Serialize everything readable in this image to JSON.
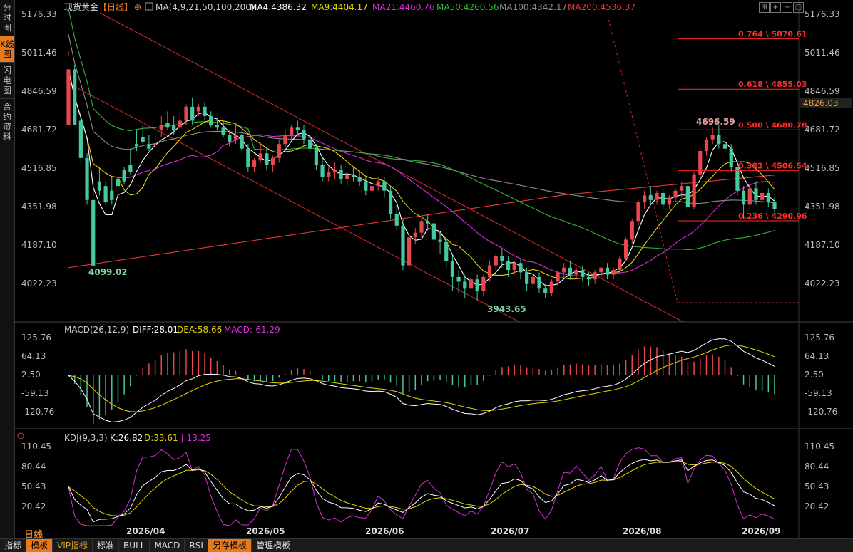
{
  "sidebar": {
    "tabs": [
      "分时图",
      "K线图",
      "闪电图",
      "合约资料"
    ],
    "active": 1
  },
  "header": {
    "name": "现货黄金",
    "period": "【日线】",
    "ma_params": "MA(4,9,21,50,100,200)",
    "ma4": "MA4:4386.32",
    "ma9": "MA9:4404.17",
    "ma21": "MA21:4460.76",
    "ma50": "MA50:4260.56",
    "ma100": "MA100:4342.17",
    "ma200": "MA200:4536.37"
  },
  "colors": {
    "up": "#e8474e",
    "down": "#46c8a0",
    "ma4": "#ffffff",
    "ma9": "#e6d400",
    "ma21": "#d431d4",
    "ma50": "#35b535",
    "ma100": "#8c8c8c",
    "ma200": "#e23a3a",
    "accent": "#e87a1e",
    "fib": "#ff2a2a"
  },
  "price_axis": [
    "5176.33",
    "5011.46",
    "4846.59",
    "4681.72",
    "4516.85",
    "4351.98",
    "4187.10",
    "4022.23"
  ],
  "current_price": "4826.03",
  "annotations": {
    "low1": "4099.02",
    "low2": "3943.65",
    "high1": "4696.59"
  },
  "fib_levels": [
    "0.764 \\ 5070.61",
    "0.618 \\ 4855.03",
    "0.500 \\ 4680.78",
    "0.382 \\ 4506.54",
    "0.236 \\ 4290.96"
  ],
  "macd": {
    "title": "MACD(26,12,9)",
    "diff": "DIFF:28.01",
    "dea": "DEA:58.66",
    "macd": "MACD:-61.29",
    "axis": [
      "125.76",
      "64.13",
      "2.50",
      "-59.13",
      "-120.76"
    ]
  },
  "kdj": {
    "title": "KDJ(9,3,3)",
    "k": "K:26.82",
    "d": "D:33.61",
    "j": "J:13.25",
    "axis": [
      "110.45",
      "80.44",
      "50.43",
      "20.42"
    ]
  },
  "x_axis": [
    "2026/04",
    "2026/05",
    "2026/06",
    "2026/07",
    "2026/08",
    "2026/09"
  ],
  "period_label": "日线",
  "bottom_buttons": [
    "指标",
    "模板",
    "VIP指标",
    "标准",
    "BULL",
    "MACD",
    "RSI",
    "另存模板",
    "管理模板"
  ],
  "chart_data": [
    {
      "type": "candlestick",
      "title": "现货黄金 日线",
      "ylim": [
        3940,
        5176.33
      ],
      "y_ticks": [
        5176.33,
        5011.46,
        4846.59,
        4681.72,
        4516.85,
        4351.98,
        4187.1,
        4022.23
      ],
      "x_ticks": [
        "2026/04",
        "2026/05",
        "2026/06",
        "2026/07",
        "2026/08",
        "2026/09"
      ],
      "candles": [
        [
          4700,
          5000,
          4940,
          5020
        ],
        [
          4940,
          4960,
          4700,
          4720
        ],
        [
          4720,
          4760,
          4560,
          4540
        ],
        [
          4560,
          4580,
          4380,
          4360
        ],
        [
          4380,
          4400,
          4099,
          4460
        ],
        [
          4460,
          4520,
          4420,
          4400
        ],
        [
          4440,
          4460,
          4370,
          4360
        ],
        [
          4420,
          4480,
          4380,
          4360
        ],
        [
          4470,
          4510,
          4440,
          4430
        ],
        [
          4510,
          4520,
          4460,
          4450
        ],
        [
          4530,
          4600,
          4500,
          4490
        ],
        [
          4620,
          4680,
          4610,
          4590
        ],
        [
          4650,
          4700,
          4630,
          4620
        ],
        [
          4620,
          4660,
          4600,
          4590
        ],
        [
          4620,
          4680,
          4620,
          4610
        ],
        [
          4680,
          4740,
          4700,
          4650
        ],
        [
          4710,
          4760,
          4690,
          4680
        ],
        [
          4700,
          4740,
          4680,
          4660
        ],
        [
          4690,
          4760,
          4720,
          4670
        ],
        [
          4720,
          4790,
          4780,
          4700
        ],
        [
          4780,
          4820,
          4720,
          4700
        ],
        [
          4760,
          4790,
          4780,
          4740
        ],
        [
          4780,
          4800,
          4740,
          4720
        ],
        [
          4740,
          4760,
          4700,
          4690
        ],
        [
          4700,
          4730,
          4690,
          4680
        ],
        [
          4690,
          4720,
          4660,
          4650
        ],
        [
          4660,
          4680,
          4630,
          4610
        ],
        [
          4640,
          4700,
          4660,
          4620
        ],
        [
          4660,
          4680,
          4600,
          4590
        ],
        [
          4600,
          4620,
          4520,
          4500
        ],
        [
          4520,
          4560,
          4550,
          4500
        ],
        [
          4550,
          4620,
          4580,
          4540
        ],
        [
          4580,
          4600,
          4530,
          4510
        ],
        [
          4530,
          4570,
          4560,
          4500
        ],
        [
          4560,
          4640,
          4620,
          4540
        ],
        [
          4620,
          4680,
          4660,
          4600
        ],
        [
          4660,
          4700,
          4690,
          4640
        ],
        [
          4690,
          4720,
          4680,
          4660
        ],
        [
          4680,
          4700,
          4640,
          4620
        ],
        [
          4640,
          4660,
          4600,
          4580
        ],
        [
          4600,
          4620,
          4530,
          4510
        ],
        [
          4530,
          4560,
          4480,
          4460
        ],
        [
          4480,
          4520,
          4500,
          4460
        ],
        [
          4500,
          4540,
          4510,
          4470
        ],
        [
          4510,
          4530,
          4470,
          4450
        ],
        [
          4470,
          4500,
          4490,
          4440
        ],
        [
          4490,
          4520,
          4480,
          4460
        ],
        [
          4480,
          4510,
          4460,
          4440
        ],
        [
          4460,
          4480,
          4420,
          4400
        ],
        [
          4420,
          4460,
          4440,
          4400
        ],
        [
          4440,
          4480,
          4460,
          4420
        ],
        [
          4460,
          4480,
          4420,
          4390
        ],
        [
          4420,
          4440,
          4320,
          4300
        ],
        [
          4320,
          4360,
          4270,
          4250
        ],
        [
          4270,
          4300,
          4100,
          4080
        ],
        [
          4100,
          4240,
          4220,
          4080
        ],
        [
          4220,
          4260,
          4240,
          4190
        ],
        [
          4240,
          4300,
          4290,
          4220
        ],
        [
          4290,
          4320,
          4280,
          4250
        ],
        [
          4280,
          4300,
          4210,
          4180
        ],
        [
          4210,
          4240,
          4200,
          4150
        ],
        [
          4200,
          4220,
          4120,
          4090
        ],
        [
          4120,
          4140,
          4050,
          3990
        ],
        [
          4050,
          4080,
          4030,
          3980
        ],
        [
          4030,
          4060,
          4000,
          3960
        ],
        [
          4000,
          4050,
          4040,
          3970
        ],
        [
          4040,
          4060,
          3990,
          3950
        ],
        [
          3990,
          4060,
          4050,
          3970
        ],
        [
          4050,
          4120,
          4100,
          4030
        ],
        [
          4100,
          4150,
          4140,
          4080
        ],
        [
          4140,
          4170,
          4120,
          4090
        ],
        [
          4120,
          4140,
          4080,
          4050
        ],
        [
          4080,
          4120,
          4110,
          4060
        ],
        [
          4110,
          4130,
          4070,
          4040
        ],
        [
          4070,
          4090,
          4020,
          3990
        ],
        [
          4020,
          4060,
          4050,
          4000
        ],
        [
          4050,
          4070,
          4000,
          3980
        ],
        [
          4000,
          4020,
          3980,
          3960
        ],
        [
          3980,
          4040,
          4030,
          3970
        ],
        [
          4030,
          4080,
          4070,
          4010
        ],
        [
          4070,
          4110,
          4090,
          4050
        ],
        [
          4090,
          4120,
          4060,
          4040
        ],
        [
          4060,
          4090,
          4080,
          4040
        ],
        [
          4080,
          4100,
          4050,
          4030
        ],
        [
          4050,
          4070,
          4040,
          4010
        ],
        [
          4040,
          4080,
          4070,
          4020
        ],
        [
          4070,
          4100,
          4090,
          4050
        ],
        [
          4090,
          4110,
          4060,
          4040
        ],
        [
          4060,
          4090,
          4080,
          4040
        ],
        [
          4080,
          4140,
          4130,
          4060
        ],
        [
          4130,
          4220,
          4210,
          4120
        ],
        [
          4210,
          4300,
          4290,
          4190
        ],
        [
          4290,
          4380,
          4370,
          4270
        ],
        [
          4370,
          4420,
          4400,
          4340
        ],
        [
          4400,
          4440,
          4380,
          4360
        ],
        [
          4380,
          4420,
          4410,
          4360
        ],
        [
          4410,
          4430,
          4360,
          4340
        ],
        [
          4360,
          4400,
          4390,
          4340
        ],
        [
          4390,
          4430,
          4420,
          4370
        ],
        [
          4420,
          4460,
          4440,
          4390
        ],
        [
          4440,
          4450,
          4350,
          4330
        ],
        [
          4350,
          4500,
          4490,
          4340
        ],
        [
          4490,
          4600,
          4590,
          4480
        ],
        [
          4590,
          4650,
          4640,
          4570
        ],
        [
          4640,
          4690,
          4660,
          4620
        ],
        [
          4660,
          4700,
          4620,
          4600
        ],
        [
          4620,
          4650,
          4600,
          4580
        ],
        [
          4600,
          4620,
          4520,
          4500
        ],
        [
          4520,
          4540,
          4420,
          4400
        ],
        [
          4420,
          4440,
          4360,
          4300
        ],
        [
          4360,
          4440,
          4430,
          4340
        ],
        [
          4430,
          4460,
          4380,
          4360
        ],
        [
          4380,
          4420,
          4410,
          4360
        ],
        [
          4410,
          4430,
          4370,
          4350
        ],
        [
          4370,
          4390,
          4340,
          4330
        ]
      ]
    },
    {
      "type": "macd",
      "title": "MACD(26,12,9)",
      "ylim": [
        -130,
        140
      ],
      "y_ticks": [
        125.76,
        64.13,
        2.5,
        -59.13,
        -120.76
      ],
      "diff_last": 28.01,
      "dea_last": 58.66,
      "macd_last": -61.29
    },
    {
      "type": "kdj",
      "title": "KDJ(9,3,3)",
      "ylim": [
        0,
        115
      ],
      "y_ticks": [
        110.45,
        80.44,
        50.43,
        20.42
      ],
      "k_last": 26.82,
      "d_last": 33.61,
      "j_last": 13.25
    }
  ]
}
